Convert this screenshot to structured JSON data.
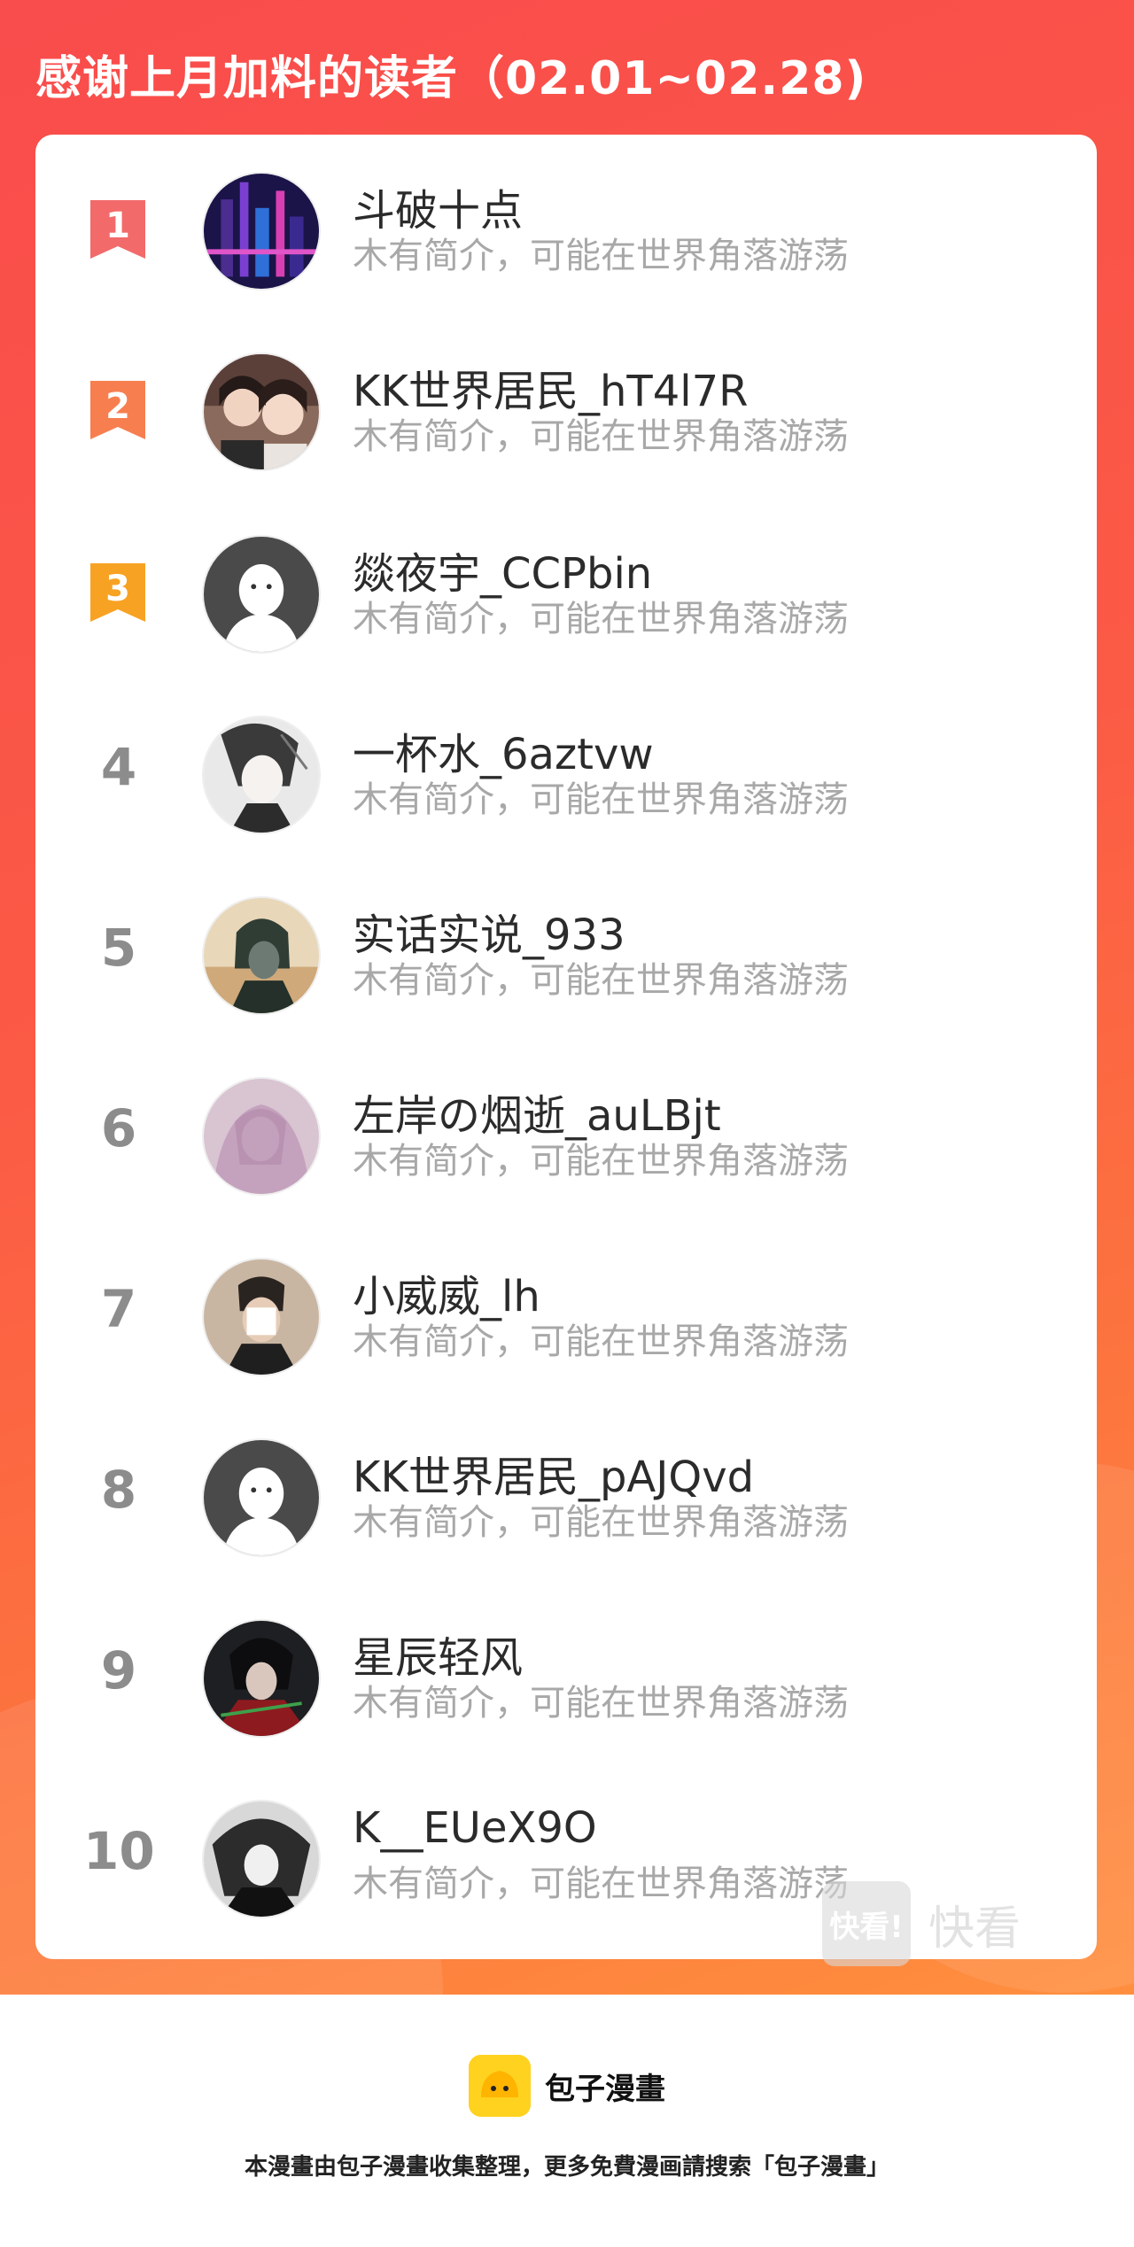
{
  "header": {
    "title": "感谢上月加料的读者（02.01~02.28)"
  },
  "readers": [
    {
      "rank": "1",
      "name": "斗破十点",
      "bio": "木有简介，可能在世界角落游荡"
    },
    {
      "rank": "2",
      "name": "KK世界居民_hT4l7R",
      "bio": "木有简介，可能在世界角落游荡"
    },
    {
      "rank": "3",
      "name": "燚夜宇_CCPbin",
      "bio": "木有简介，可能在世界角落游荡"
    },
    {
      "rank": "4",
      "name": "一杯水_6aztvw",
      "bio": "木有简介，可能在世界角落游荡"
    },
    {
      "rank": "5",
      "name": "实话实说_933",
      "bio": "木有简介，可能在世界角落游荡"
    },
    {
      "rank": "6",
      "name": "左岸の烟逝_auLBjt",
      "bio": "木有简介，可能在世界角落游荡"
    },
    {
      "rank": "7",
      "name": "小威威_lh",
      "bio": "木有简介，可能在世界角落游荡"
    },
    {
      "rank": "8",
      "name": "KK世界居民_pAJQvd",
      "bio": "木有简介，可能在世界角落游荡"
    },
    {
      "rank": "9",
      "name": "星辰轻风",
      "bio": "木有简介，可能在世界角落游荡"
    },
    {
      "rank": "10",
      "name": "K__EUeX9O",
      "bio": "木有简介，可能在世界角落游荡"
    }
  ],
  "watermark": {
    "icon_text": "快看!",
    "text": "快看"
  },
  "footer": {
    "brand_name": "包子漫畫",
    "disclaimer": "本漫畫由包子漫畫收集整理，更多免費漫画請搜索「包子漫畫」"
  },
  "colors": {
    "header_bg": "#f94c4c",
    "rank1": "#f26a6a",
    "rank2": "#f77e4f",
    "rank3": "#f8a223",
    "brand_yellow": "#ffd21f"
  }
}
